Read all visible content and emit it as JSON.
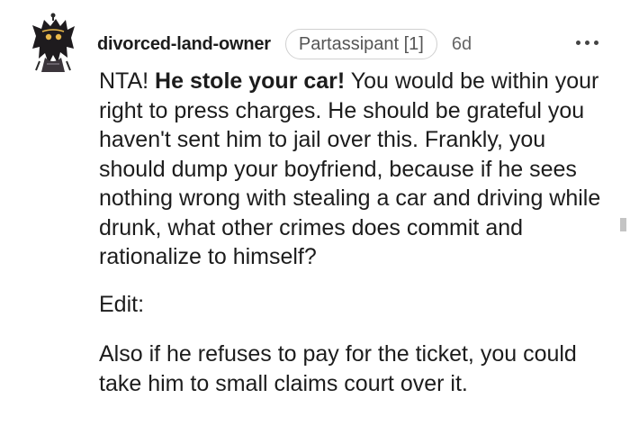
{
  "comment": {
    "author": "divorced-land-owner",
    "flair": "Partassipant [1]",
    "age": "6d",
    "menu_icon": "more-horizontal-icon",
    "avatar_icon": "avatar-icon",
    "paragraph1": {
      "lead": "NTA! ",
      "bold": "He stole your car!",
      "rest": " You would be within your right to press charges. He should be grateful you haven't sent him to jail over this. Frankly, you should dump your boyfriend, because if he sees nothing wrong with stealing a car and driving while drunk, what other crimes does commit and rationalize to himself?"
    },
    "paragraph2": "Edit:",
    "paragraph3": "Also if he refuses to pay for the ticket, you could take him to small claims court over it."
  },
  "colors": {
    "text": "#1c1c1c",
    "meta": "#666666",
    "flair_border": "#d0d0d0",
    "avatar_gold": "#e8b84a"
  }
}
